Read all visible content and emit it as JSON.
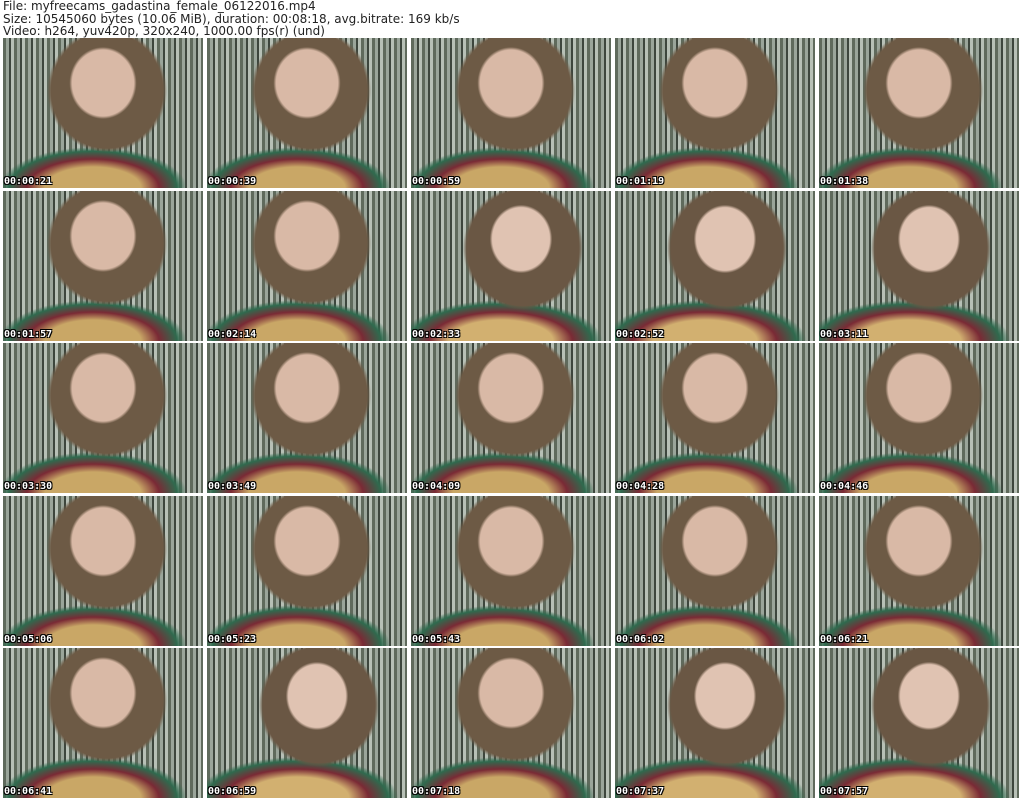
{
  "header": {
    "file": "File: myfreecams_gadastina_female_06122016.mp4",
    "size": "Size: 10545060 bytes (10.06 MiB), duration: 00:08:18, avg.bitrate: 169 kb/s",
    "video": "Video: h264, yuv420p, 320x240, 1000.00 fps(r) (und)"
  },
  "thumbnails": [
    {
      "timestamp": "00:00:21"
    },
    {
      "timestamp": "00:00:39"
    },
    {
      "timestamp": "00:00:59"
    },
    {
      "timestamp": "00:01:19"
    },
    {
      "timestamp": "00:01:38"
    },
    {
      "timestamp": "00:01:57"
    },
    {
      "timestamp": "00:02:14"
    },
    {
      "timestamp": "00:02:33"
    },
    {
      "timestamp": "00:02:52"
    },
    {
      "timestamp": "00:03:11"
    },
    {
      "timestamp": "00:03:30"
    },
    {
      "timestamp": "00:03:49"
    },
    {
      "timestamp": "00:04:09"
    },
    {
      "timestamp": "00:04:28"
    },
    {
      "timestamp": "00:04:46"
    },
    {
      "timestamp": "00:05:06"
    },
    {
      "timestamp": "00:05:23"
    },
    {
      "timestamp": "00:05:43"
    },
    {
      "timestamp": "00:06:02"
    },
    {
      "timestamp": "00:06:21"
    },
    {
      "timestamp": "00:06:41"
    },
    {
      "timestamp": "00:06:59"
    },
    {
      "timestamp": "00:07:18"
    },
    {
      "timestamp": "00:07:37"
    },
    {
      "timestamp": "00:07:57"
    }
  ]
}
